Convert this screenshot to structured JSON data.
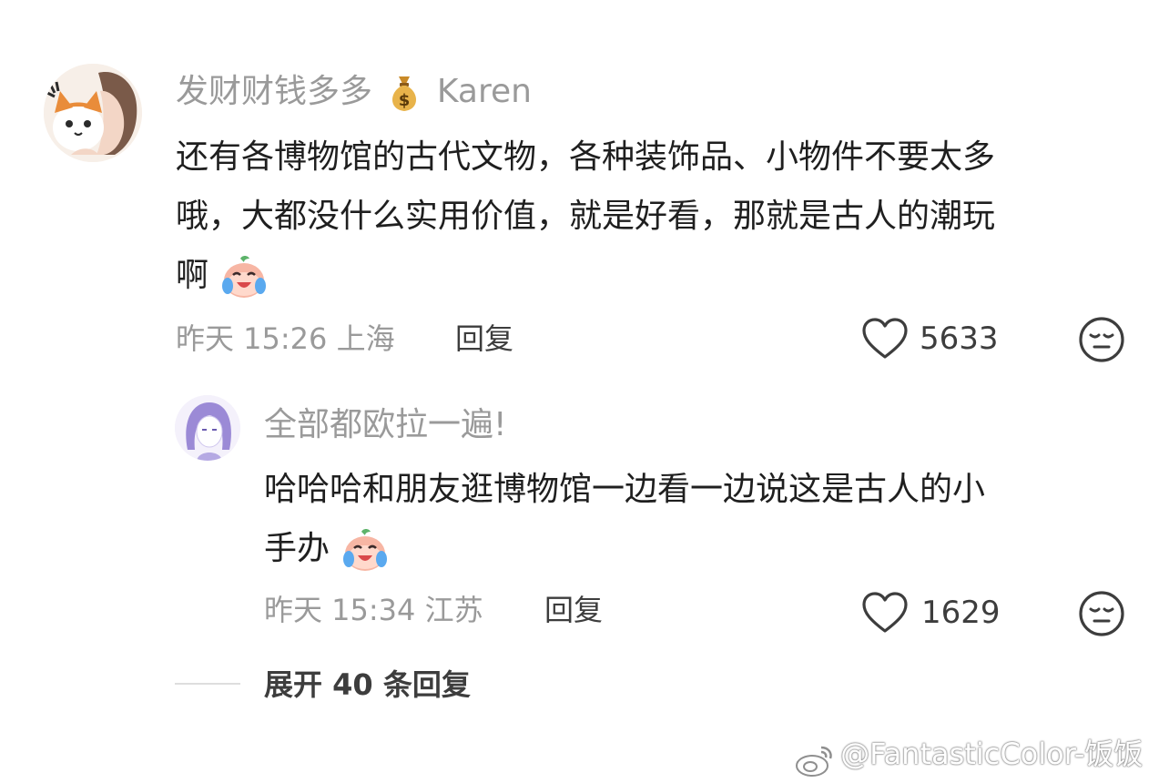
{
  "comment": {
    "username": "发财财钱多多",
    "username_suffix": "Karen",
    "username_emoji": "money-bag-icon",
    "text_lines": [
      "还有各博物馆的古代文物，各种装饰品、小物件不要太多",
      "哦，大都没什么实用价值，就是好看，那就是古人的潮玩",
      "啊"
    ],
    "time": "昨天 15:26",
    "location": "上海",
    "reply_label": "回复",
    "likes": "5633"
  },
  "reply": {
    "username": "全部都欧拉一遍!",
    "text_lines": [
      "哈哈哈和朋友逛博物馆一边看一边说这是古人的小",
      "手办"
    ],
    "time": "昨天 15:34",
    "location": "江苏",
    "reply_label": "回复",
    "likes": "1629"
  },
  "expand": {
    "label": "展开 40 条回复"
  },
  "watermark": {
    "text": "@FantasticColor-饭饭"
  },
  "colors": {
    "meta_gray": "#9a9a9a",
    "text_dark": "#1f1f1f",
    "background": "#ffffff"
  }
}
